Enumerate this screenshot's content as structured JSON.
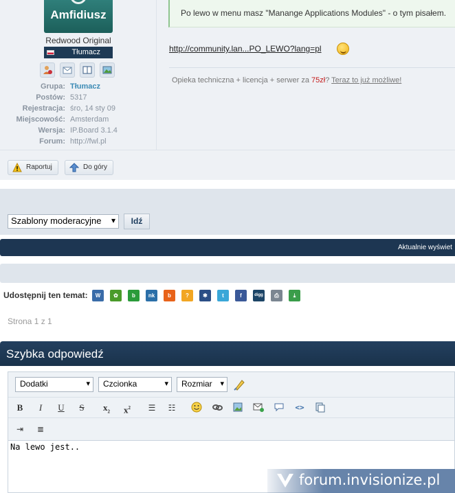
{
  "author": {
    "avatar_text": "Amfidiusz",
    "member_title": "Redwood Original",
    "rank_badge": "Tłumacz",
    "icons": [
      "user-card-icon",
      "message-icon",
      "blog-icon",
      "gallery-icon"
    ],
    "info": [
      {
        "label": "Grupa:",
        "value": "Tłumacz"
      },
      {
        "label": "Postów:",
        "value": "5317"
      },
      {
        "label": "Rejestracja:",
        "value": "śro, 14 sty 09"
      },
      {
        "label": "Miejscowość:",
        "value": "Amsterdam"
      },
      {
        "label": "Wersja:",
        "value": "IP.Board 3.1.4"
      },
      {
        "label": "Forum:",
        "value": "http://fwl.pl"
      }
    ]
  },
  "post": {
    "quote_text": "Po lewo w menu masz \"Manange Applications Modules\" - o tym pisałem.",
    "link_text": "http://community.lan...PO_LEWO?lang=pl",
    "signature": {
      "text_before": "Opieka techniczna + licencja + serwer za ",
      "price": "75zł",
      "text_after": "?",
      "link": "Teraz to już możliwe!"
    },
    "controls": {
      "report": "Raportuj",
      "top": "Do góry"
    }
  },
  "moderation": {
    "select_value": "Szablony moderacyjne",
    "go_label": "Idź"
  },
  "status_bar_text": "Aktualnie wyświet",
  "share": {
    "label": "Udostępnij ten temat:",
    "services": [
      {
        "icon": "wykop-icon",
        "color": "#3a6ca8",
        "glyph": "W"
      },
      {
        "icon": "flaker-icon",
        "color": "#4a9b2a",
        "glyph": "✿"
      },
      {
        "icon": "blip-icon",
        "color": "#2a9b3a",
        "glyph": "b"
      },
      {
        "icon": "nk-icon",
        "color": "#2b6fa8",
        "glyph": "nk"
      },
      {
        "icon": "buzz-icon",
        "color": "#e8631a",
        "glyph": "b"
      },
      {
        "icon": "ask-icon",
        "color": "#f2a623",
        "glyph": "?"
      },
      {
        "icon": "myspace-icon",
        "color": "#2b4e86",
        "glyph": "✱"
      },
      {
        "icon": "twitter-icon",
        "color": "#3aa7d8",
        "glyph": "t"
      },
      {
        "icon": "facebook-icon",
        "color": "#3b5998",
        "glyph": "f"
      },
      {
        "icon": "digg-icon",
        "color": "#1c4466",
        "glyph": "digg"
      },
      {
        "icon": "print-icon",
        "color": "#7b8691",
        "glyph": "⎙"
      },
      {
        "icon": "download-icon",
        "color": "#3a9d4a",
        "glyph": "⤓"
      }
    ]
  },
  "pagination": "Strona 1 z 1",
  "quick_reply": {
    "title": "Szybka odpowiedź",
    "selects": {
      "extras": "Dodatki",
      "font": "Czcionka",
      "size": "Rozmiar"
    },
    "textarea_value": "Na lewo jest.."
  },
  "watermark": "forum.invisionize.pl"
}
